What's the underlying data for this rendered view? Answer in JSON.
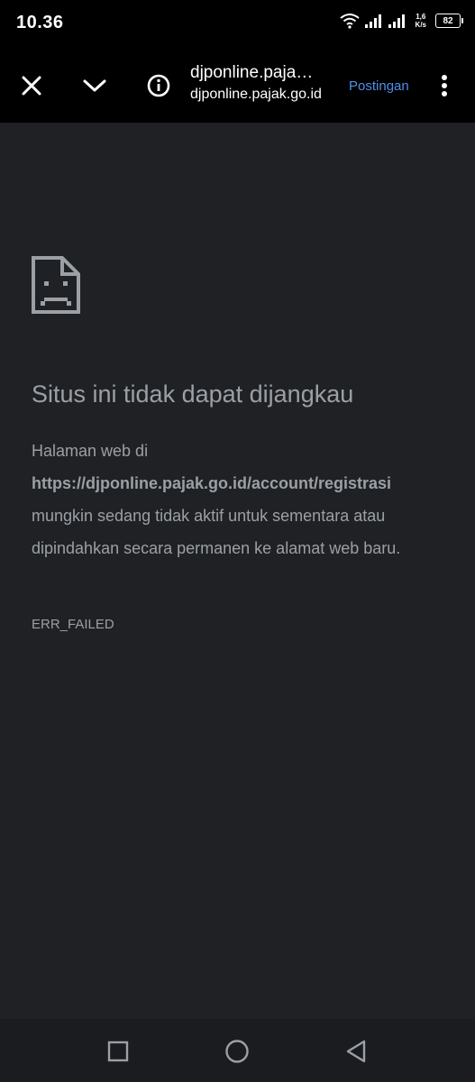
{
  "status_bar": {
    "time": "10.36",
    "net_speed_value": "1,6",
    "net_speed_unit": "K/s",
    "battery": "82"
  },
  "toolbar": {
    "page_title": "djponline.paja…",
    "page_domain": "djponline.pajak.go.id",
    "action_label": "Postingan",
    "icons": {
      "close": "close-icon",
      "chevron": "chevron-down-icon",
      "info": "info-icon",
      "menu": "more-vert-icon"
    }
  },
  "error_page": {
    "title": "Situs ini tidak dapat dijangkau",
    "body_prefix": "Halaman web di",
    "url": "https://djponline.pajak.go.id/account/registrasi",
    "body_suffix": "mungkin sedang tidak aktif untuk sementara atau dipindahkan secara permanen ke alamat web baru.",
    "error_code": "ERR_FAILED",
    "icon": "sad-document-icon"
  },
  "colors": {
    "background": "#202124",
    "bar": "#000000",
    "text_muted": "#9aa0a6",
    "accent": "#4f8fe8"
  }
}
